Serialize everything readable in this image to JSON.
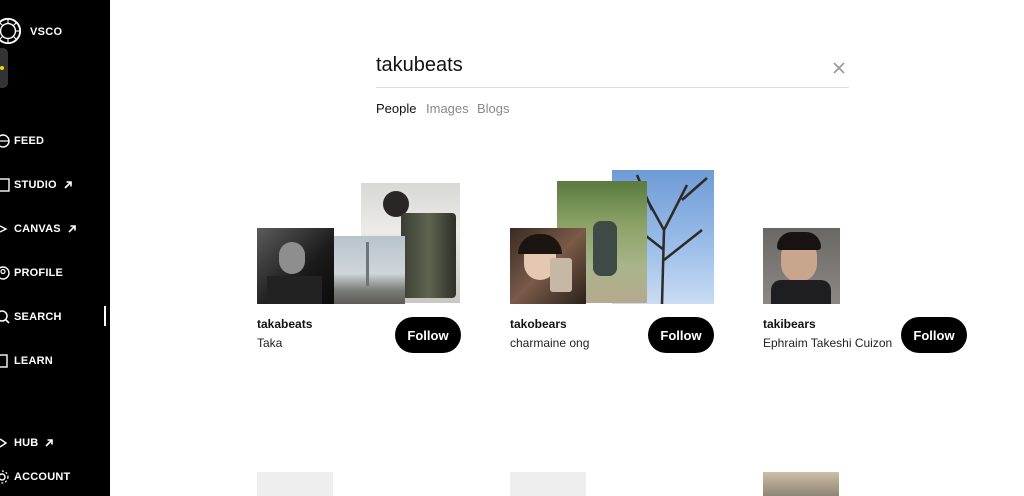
{
  "app": {
    "logo_text": "VSCO"
  },
  "sidebar": {
    "items": [
      {
        "label": "FEED",
        "icon": "globe-icon",
        "external": false
      },
      {
        "label": "STUDIO",
        "icon": "studio-icon",
        "external": true
      },
      {
        "label": "CANVAS",
        "icon": "canvas-icon",
        "external": true
      },
      {
        "label": "PROFILE",
        "icon": "profile-icon",
        "external": false
      },
      {
        "label": "SEARCH",
        "icon": "search-icon",
        "external": false,
        "active": true
      },
      {
        "label": "LEARN",
        "icon": "learn-icon",
        "external": false
      },
      {
        "label": "HUB",
        "icon": "hub-icon",
        "external": true
      },
      {
        "label": "ACCOUNT",
        "icon": "gear-icon",
        "external": false
      }
    ]
  },
  "search": {
    "query": "takubeats",
    "tabs": [
      {
        "label": "People",
        "active": true
      },
      {
        "label": "Images",
        "active": false
      },
      {
        "label": "Blogs",
        "active": false
      }
    ]
  },
  "results": [
    {
      "username": "takabeats",
      "display_name": "Taka",
      "follow_label": "Follow"
    },
    {
      "username": "takobears",
      "display_name": "charmaine ong",
      "follow_label": "Follow"
    },
    {
      "username": "takibears",
      "display_name": "Ephraim Takeshi Cuizon",
      "follow_label": "Follow"
    }
  ],
  "colors": {
    "sidebar_bg": "#000000",
    "accent_dot": "#f5d90a",
    "button_bg": "#000000"
  }
}
